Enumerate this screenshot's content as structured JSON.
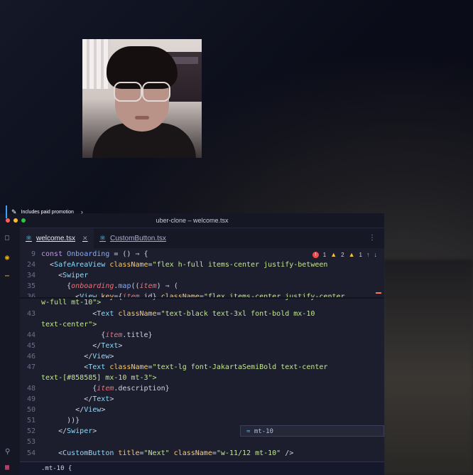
{
  "promo": {
    "label": "Includes paid promotion"
  },
  "window": {
    "title": "uber-clone – welcome.tsx"
  },
  "tabs": [
    {
      "label": "welcome.tsx",
      "active": true
    },
    {
      "label": "CustomButton.tsx",
      "active": false
    }
  ],
  "problems": {
    "errors": "1",
    "warnings": "2",
    "infos": "1"
  },
  "code_lines": [
    {
      "num": "9",
      "parts": [
        [
          "kw",
          "const "
        ],
        [
          "fn",
          "Onboarding"
        ],
        [
          "pl",
          " = () ⇒ {"
        ]
      ]
    },
    {
      "num": "24",
      "parts": [
        [
          "pl",
          "  <"
        ],
        [
          "tag",
          "SafeAreaView"
        ],
        [
          "attr",
          " className"
        ],
        [
          "pl",
          "="
        ],
        [
          "str",
          "\"flex h-full items-center justify-between"
        ]
      ]
    },
    {
      "num": "34",
      "parts": [
        [
          "pl",
          "    <"
        ],
        [
          "tag",
          "Swiper"
        ]
      ]
    },
    {
      "num": "35",
      "parts": [
        [
          "pl",
          "      {"
        ],
        [
          "id",
          "onboarding"
        ],
        [
          "pl",
          "."
        ],
        [
          "fn",
          "map"
        ],
        [
          "pl",
          "(("
        ],
        [
          "id",
          "item"
        ],
        [
          "pl",
          ") ⇒ ("
        ]
      ]
    },
    {
      "num": "36",
      "parts": [
        [
          "pl",
          "        <"
        ],
        [
          "tag",
          "View"
        ],
        [
          "attr",
          " key"
        ],
        [
          "pl",
          "={"
        ],
        [
          "id",
          "item"
        ],
        [
          "pl",
          ".id} "
        ],
        [
          "attr",
          "className"
        ],
        [
          "pl",
          "="
        ],
        [
          "str",
          "\"flex items-center justify-center"
        ]
      ]
    },
    {
      "num": "",
      "parts": [
        [
          "str",
          "w-full mt-10\">"
        ]
      ]
    },
    {
      "num": "43",
      "parts": [
        [
          "pl",
          "            <"
        ],
        [
          "tag",
          "Text"
        ],
        [
          "attr",
          " className"
        ],
        [
          "pl",
          "="
        ],
        [
          "str",
          "\"text-black text-3xl font-bold mx-10"
        ]
      ]
    },
    {
      "num": "",
      "parts": [
        [
          "str",
          "text-center\">"
        ]
      ]
    },
    {
      "num": "44",
      "parts": [
        [
          "pl",
          "              {"
        ],
        [
          "id",
          "item"
        ],
        [
          "pl",
          ".title}"
        ]
      ]
    },
    {
      "num": "45",
      "parts": [
        [
          "pl",
          "            </"
        ],
        [
          "tag",
          "Text"
        ],
        [
          "pl",
          ">"
        ]
      ]
    },
    {
      "num": "46",
      "parts": [
        [
          "pl",
          "          </"
        ],
        [
          "tag",
          "View"
        ],
        [
          "pl",
          ">"
        ]
      ]
    },
    {
      "num": "47",
      "parts": [
        [
          "pl",
          "          <"
        ],
        [
          "tag",
          "Text"
        ],
        [
          "attr",
          " className"
        ],
        [
          "pl",
          "="
        ],
        [
          "str",
          "\"text-lg font-JakartaSemiBold text-center"
        ]
      ]
    },
    {
      "num": "",
      "parts": [
        [
          "str",
          "text-[#858585] mx-10 mt-3\">"
        ]
      ]
    },
    {
      "num": "48",
      "parts": [
        [
          "pl",
          "            {"
        ],
        [
          "id",
          "item"
        ],
        [
          "pl",
          ".description}"
        ]
      ]
    },
    {
      "num": "49",
      "parts": [
        [
          "pl",
          "          </"
        ],
        [
          "tag",
          "Text"
        ],
        [
          "pl",
          ">"
        ]
      ]
    },
    {
      "num": "50",
      "parts": [
        [
          "pl",
          "        </"
        ],
        [
          "tag",
          "View"
        ],
        [
          "pl",
          ">"
        ]
      ]
    },
    {
      "num": "51",
      "parts": [
        [
          "pl",
          "      ))}"
        ]
      ]
    },
    {
      "num": "52",
      "parts": [
        [
          "pl",
          "    </"
        ],
        [
          "tag",
          "Swiper"
        ],
        [
          "pl",
          ">"
        ]
      ]
    },
    {
      "num": "53",
      "parts": [
        [
          "pl",
          ""
        ]
      ]
    },
    {
      "num": "54",
      "parts": [
        [
          "pl",
          "    <"
        ],
        [
          "tag",
          "CustomButton"
        ],
        [
          "attr",
          " title"
        ],
        [
          "pl",
          "="
        ],
        [
          "str",
          "\"Next\""
        ],
        [
          "attr",
          " className"
        ],
        [
          "pl",
          "="
        ],
        [
          "str",
          "\"w-11/12 mt-10\""
        ],
        [
          "pl",
          " />"
        ]
      ]
    }
  ],
  "suggestion": {
    "label": "mt-10"
  },
  "bottom_panel": {
    "text": ".mt-10 {"
  },
  "icons": {
    "explorer": "files-icon",
    "source_control": "git-icon",
    "more": "ellipsis-icon",
    "search": "search-icon",
    "extensions": "extensions-icon"
  }
}
